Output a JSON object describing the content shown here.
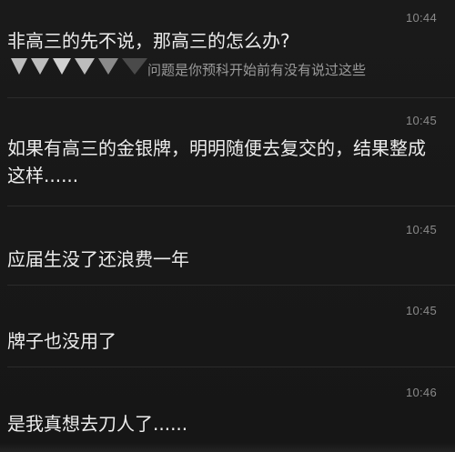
{
  "comments": [
    {
      "time": "10:44",
      "text": "非高三的先不说，那高三的怎么办?",
      "quote": "问题是你预科开始前有没有说过这些"
    },
    {
      "time": "10:45",
      "text": "如果有高三的金银牌，明明随便去复交的，结果整成这样......"
    },
    {
      "time": "10:45",
      "text": "应届生没了还浪费一年"
    },
    {
      "time": "10:45",
      "text": "牌子也没用了"
    },
    {
      "time": "10:46",
      "text": "是我真想去刀人了......"
    }
  ]
}
